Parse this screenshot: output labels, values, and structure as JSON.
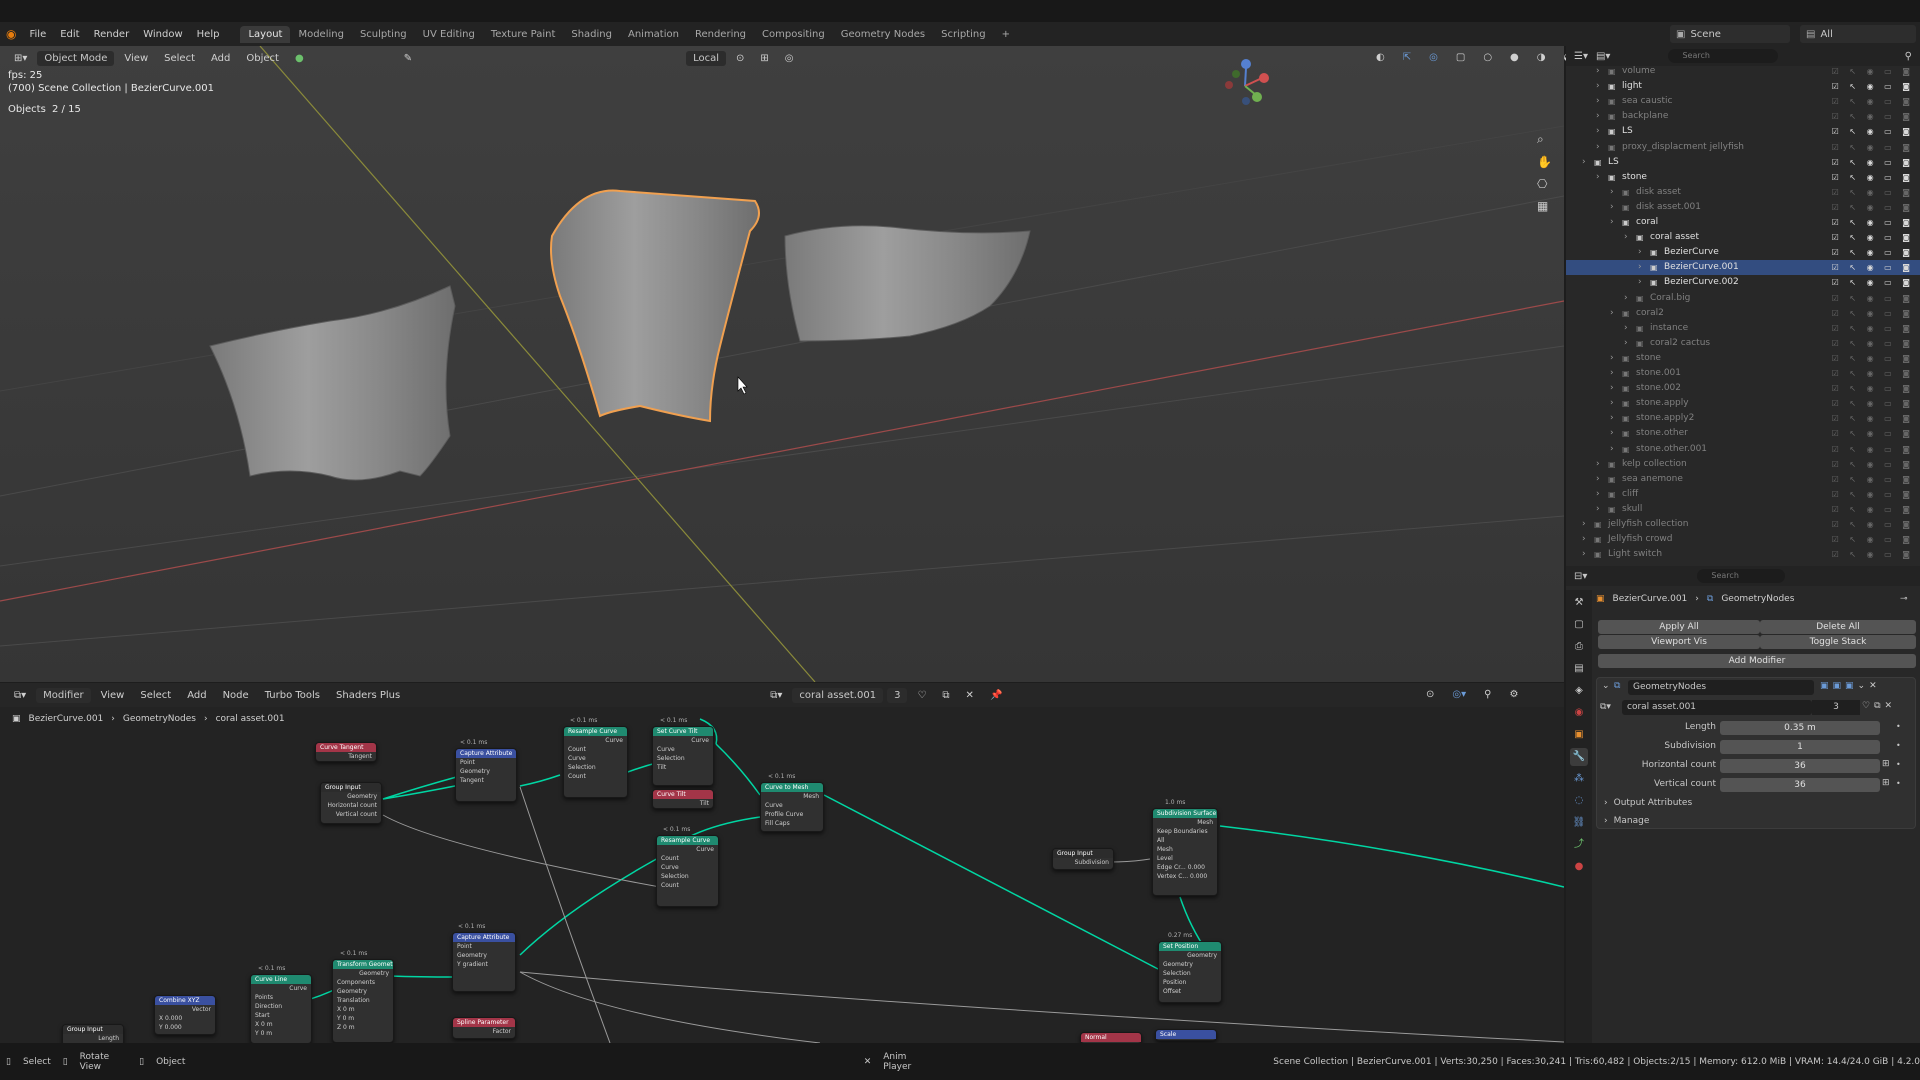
{
  "menubar": {
    "file": "File",
    "edit": "Edit",
    "render": "Render",
    "window": "Window",
    "help": "Help",
    "workspaces": [
      "Layout",
      "Modeling",
      "Sculpting",
      "UV Editing",
      "Texture Paint",
      "Shading",
      "Animation",
      "Rendering",
      "Compositing",
      "Geometry Nodes",
      "Scripting"
    ],
    "add_workspace": "+",
    "scene": "Scene",
    "view_layer": "All"
  },
  "viewport": {
    "mode": "Object Mode",
    "view": "View",
    "select": "Select",
    "add": "Add",
    "object": "Object",
    "orientation": "Local",
    "fps": "fps: 25",
    "collection_line": "(700) Scene Collection | BezierCurve.001",
    "objects_label": "Objects",
    "objects_count": "2 / 15"
  },
  "node_editor": {
    "editor": "Modifier",
    "view": "View",
    "select": "Select",
    "add": "Add",
    "node": "Node",
    "turbo": "Turbo Tools",
    "shaders": "Shaders Plus",
    "nodegroup": "coral asset.001",
    "users": "3",
    "crumb1": "BezierCurve.001",
    "crumb2": "GeometryNodes",
    "crumb3": "coral asset.001"
  },
  "nodes": {
    "curve_tangent": {
      "title": "Curve Tangent",
      "out": "Tangent"
    },
    "group_input": {
      "title": "Group Input",
      "rows": [
        "Geometry",
        "Horizontal count",
        "Vertical count"
      ]
    },
    "capture1": {
      "time": "< 0.1 ms",
      "title": "Capture Attribute",
      "rows": [
        "Point",
        "Geometry",
        "Tangent"
      ]
    },
    "resample1": {
      "time": "< 0.1 ms",
      "title": "Resample Curve",
      "rows": [
        "Curve",
        "Count",
        "Curve",
        "Selection",
        "Count"
      ]
    },
    "set_tilt": {
      "time": "< 0.1 ms",
      "title": "Set Curve Tilt",
      "rows": [
        "Curve",
        "Curve",
        "Selection",
        "Tilt"
      ]
    },
    "curve_tilt": {
      "title": "Curve Tilt",
      "out": "Tilt"
    },
    "curve_to_mesh": {
      "time": "< 0.1 ms",
      "title": "Curve to Mesh",
      "rows": [
        "Mesh",
        "Curve",
        "Profile Curve",
        "Fill Caps"
      ]
    },
    "resample2": {
      "time": "< 0.1 ms",
      "title": "Resample Curve",
      "rows": [
        "Curve",
        "Count",
        "Curve",
        "Selection",
        "Count"
      ]
    },
    "subdivision": {
      "time": "1.0 ms",
      "title": "Subdivision Surface",
      "rows": [
        "Mesh",
        "Keep Boundaries",
        "All",
        "Mesh",
        "Level",
        "Edge Cr... 0.000",
        "Vertex C... 0.000"
      ]
    },
    "group_input2": {
      "title": "Group Input",
      "rows": [
        "Subdivision"
      ]
    },
    "set_position": {
      "time": "0.27 ms",
      "title": "Set Position",
      "rows": [
        "Geometry",
        "Geometry",
        "Selection",
        "Position",
        "Offset"
      ]
    },
    "capture2": {
      "time": "< 0.1 ms",
      "title": "Capture Attribute",
      "rows": [
        "Point",
        "Geometry",
        "Y gradient"
      ]
    },
    "transform": {
      "time": "< 0.1 ms",
      "title": "Transform Geometry",
      "rows": [
        "Geometry",
        "Components",
        "Geometry",
        "Translation",
        "X 0 m",
        "Y 0 m",
        "Z 0 m"
      ]
    },
    "curve_line": {
      "time": "< 0.1 ms",
      "title": "Curve Line",
      "rows": [
        "Curve",
        "Points",
        "Direction",
        "Start",
        "X 0 m",
        "Y 0 m"
      ]
    },
    "combine_xyz": {
      "title": "Combine XYZ",
      "rows": [
        "Vector",
        "X 0.000",
        "Y 0.000"
      ]
    },
    "group_input3": {
      "title": "Group Input",
      "rows": [
        "Length"
      ]
    },
    "spline_param": {
      "title": "Spline Parameter",
      "rows": [
        "Factor"
      ]
    },
    "normal": {
      "title": "Normal"
    },
    "scale": {
      "title": "Scale"
    }
  },
  "outliner": {
    "search_placeholder": "Search",
    "rows": [
      {
        "label": "volume",
        "indent": 2,
        "dim": true
      },
      {
        "label": "light",
        "indent": 2,
        "dim": false
      },
      {
        "label": "sea caustic",
        "indent": 2,
        "dim": true
      },
      {
        "label": "backplane",
        "indent": 2,
        "dim": true
      },
      {
        "label": "LS",
        "indent": 2,
        "dim": false
      },
      {
        "label": "proxy_displacment jellyfish",
        "indent": 2,
        "dim": true
      },
      {
        "label": "LS",
        "indent": 1,
        "dim": false
      },
      {
        "label": "stone",
        "indent": 2,
        "dim": false
      },
      {
        "label": "disk asset",
        "indent": 3,
        "dim": true
      },
      {
        "label": "disk asset.001",
        "indent": 3,
        "dim": true
      },
      {
        "label": "coral",
        "indent": 3,
        "dim": false
      },
      {
        "label": "coral asset",
        "indent": 4,
        "dim": false
      },
      {
        "label": "BezierCurve",
        "indent": 5,
        "dim": false
      },
      {
        "label": "BezierCurve.001",
        "indent": 5,
        "dim": false,
        "selected": true
      },
      {
        "label": "BezierCurve.002",
        "indent": 5,
        "dim": false
      },
      {
        "label": "Coral.big",
        "indent": 4,
        "dim": true
      },
      {
        "label": "coral2",
        "indent": 3,
        "dim": true
      },
      {
        "label": "instance",
        "indent": 4,
        "dim": true
      },
      {
        "label": "coral2 cactus",
        "indent": 4,
        "dim": true
      },
      {
        "label": "stone",
        "indent": 3,
        "dim": true
      },
      {
        "label": "stone.001",
        "indent": 3,
        "dim": true
      },
      {
        "label": "stone.002",
        "indent": 3,
        "dim": true
      },
      {
        "label": "stone.apply",
        "indent": 3,
        "dim": true
      },
      {
        "label": "stone.apply2",
        "indent": 3,
        "dim": true
      },
      {
        "label": "stone.other",
        "indent": 3,
        "dim": true
      },
      {
        "label": "stone.other.001",
        "indent": 3,
        "dim": true
      },
      {
        "label": "kelp collection",
        "indent": 2,
        "dim": true
      },
      {
        "label": "sea anemone",
        "indent": 2,
        "dim": true
      },
      {
        "label": "cliff",
        "indent": 2,
        "dim": true
      },
      {
        "label": "skull",
        "indent": 2,
        "dim": true
      },
      {
        "label": "jellyfish collection",
        "indent": 1,
        "dim": true
      },
      {
        "label": "Jellyfish crowd",
        "indent": 1,
        "dim": true
      },
      {
        "label": "Light switch",
        "indent": 1,
        "dim": true
      }
    ]
  },
  "properties": {
    "search_placeholder": "Search",
    "crumb_object": "BezierCurve.001",
    "crumb_modifier": "GeometryNodes",
    "apply_all": "Apply All",
    "delete_all": "Delete All",
    "viewport_vis": "Viewport Vis",
    "toggle_stack": "Toggle Stack",
    "add_modifier": "Add Modifier",
    "modifier_name": "GeometryNodes",
    "nodegroup": "coral asset.001",
    "nodegroup_users": "3",
    "length_label": "Length",
    "length_value": "0.35 m",
    "subdivision_label": "Subdivision",
    "subdivision_value": "1",
    "hcount_label": "Horizontal count",
    "hcount_value": "36",
    "vcount_label": "Vertical count",
    "vcount_value": "36",
    "output_attributes": "Output Attributes",
    "manage": "Manage"
  },
  "statusbar": {
    "select": "Select",
    "rotate": "Rotate View",
    "object": "Object",
    "anim": "Anim Player",
    "stats": "Scene Collection | BezierCurve.001 | Verts:30,250 | Faces:30,241 | Tris:60,482 | Objects:2/15 | Memory: 612.0 MiB | VRAM: 14.4/24.0 GiB | 4.2.0"
  },
  "colors": {
    "accent": "#4772b3",
    "selection_outline": "#f0a050",
    "geometry_socket": "#00d6a3"
  }
}
